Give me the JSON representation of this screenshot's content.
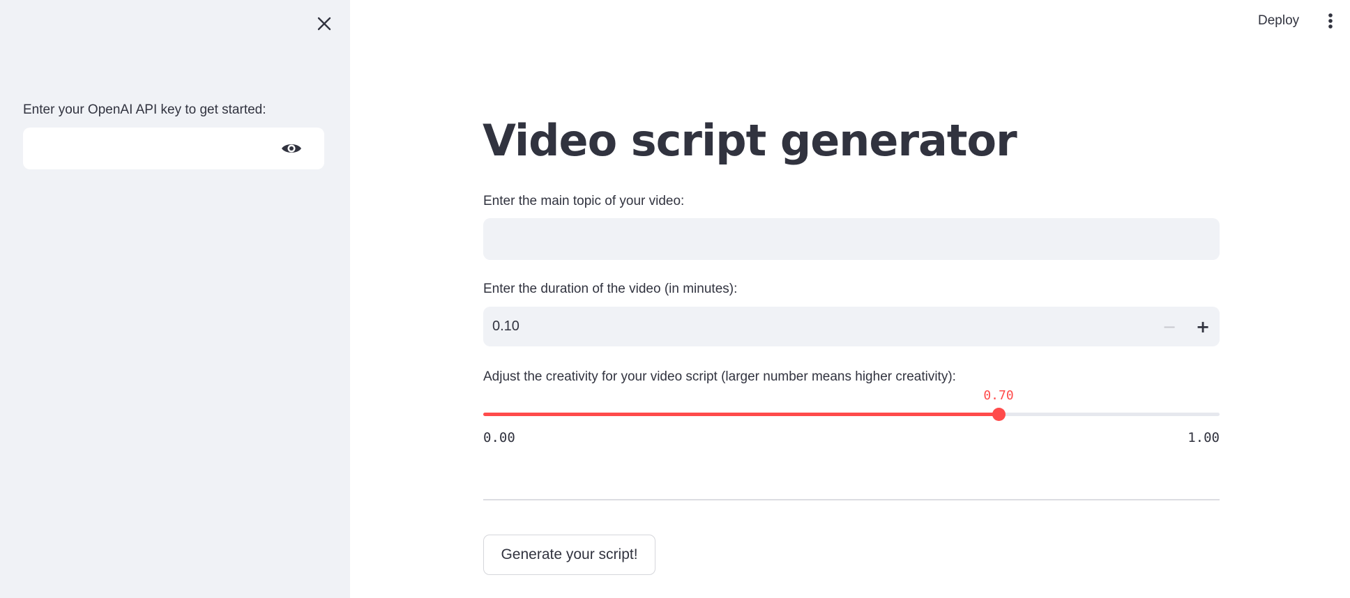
{
  "sidebar": {
    "api_key_label": "Enter your OpenAI API key to get started:",
    "api_key_value": "",
    "icons": {
      "close": "close-icon",
      "visibility": "eye-icon"
    }
  },
  "header": {
    "deploy_label": "Deploy",
    "menu_icon": "vertical-dots-icon"
  },
  "main": {
    "title": "Video script generator",
    "topic": {
      "label": "Enter the main topic of your video:",
      "value": ""
    },
    "duration": {
      "label": "Enter the duration of the video (in minutes):",
      "value": "0.10",
      "decrement_symbol": "−",
      "increment_symbol": "+"
    },
    "creativity": {
      "label": "Adjust the creativity for your video script (larger number means higher creativity):",
      "value": 0.7,
      "value_text": "0.70",
      "min": 0.0,
      "max": 1.0,
      "min_text": "0.00",
      "max_text": "1.00"
    },
    "generate_label": "Generate your script!"
  },
  "colors": {
    "accent": "#ff4b4b",
    "sidebar_bg": "#f0f2f6",
    "text": "#31333f"
  }
}
